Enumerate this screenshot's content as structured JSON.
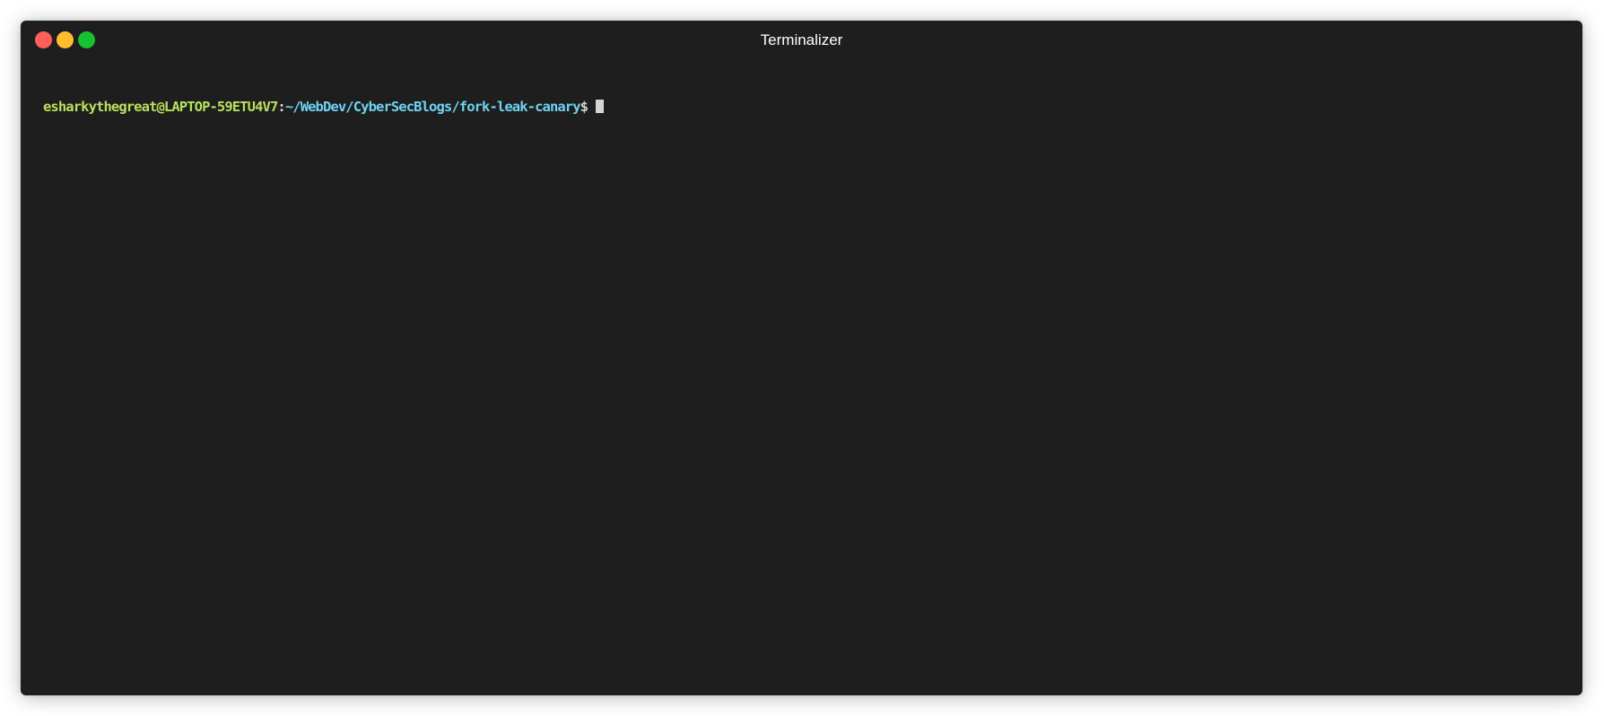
{
  "window": {
    "title": "Terminalizer",
    "background": "#1e1e1e"
  },
  "traffic_lights": {
    "close_color": "#ff5f58",
    "minimize_color": "#ffbd2e",
    "maximize_color": "#18c132"
  },
  "prompt": {
    "user_host": "esharkythegreat@LAPTOP-59ETU4V7",
    "separator": ":",
    "path": "~/WebDev/CyberSecBlogs/fork-leak-canary",
    "symbol": "$",
    "colors": {
      "user_host": "#b8e05c",
      "separator": "#d4d4d4",
      "path": "#6fd3f2",
      "symbol": "#d4d4d4",
      "cursor": "#d4d4d4"
    }
  }
}
